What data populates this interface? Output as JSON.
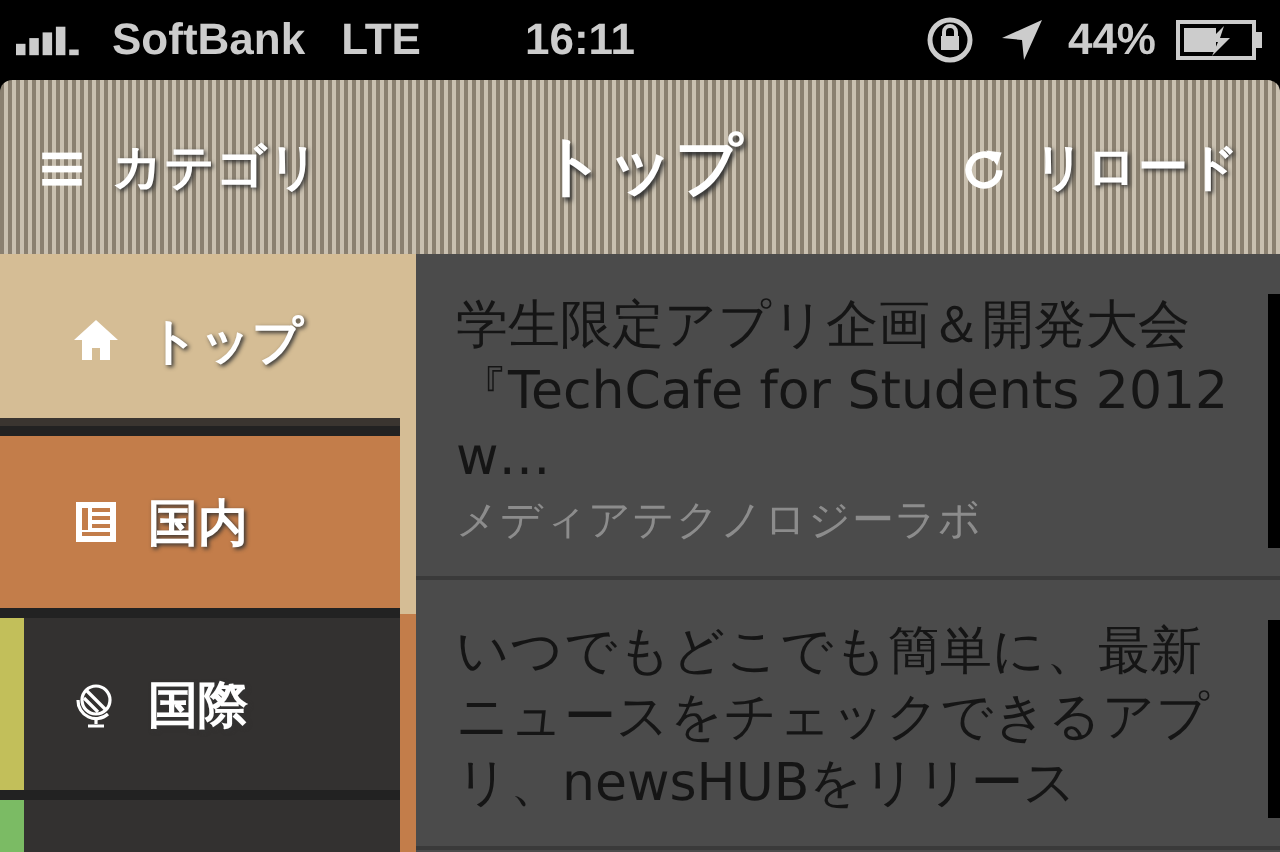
{
  "status_bar": {
    "carrier": "SoftBank",
    "network": "LTE",
    "time": "16:11",
    "battery": "44%"
  },
  "nav_bar": {
    "left_button": "カテゴリ",
    "title": "トップ",
    "right_button": "リロード"
  },
  "sidebar": {
    "items": [
      {
        "label": "トップ",
        "selected": true,
        "highlighted": false
      },
      {
        "label": "国内",
        "selected": false,
        "highlighted": true,
        "color": "#c37d4a"
      },
      {
        "label": "国際",
        "selected": false,
        "highlighted": false,
        "color": "#c2bf5a"
      },
      {
        "selected": false,
        "highlighted": false,
        "color": "#7bbb64"
      }
    ]
  },
  "articles": [
    {
      "title": "学生限定アプリ企画＆開発大会『TechCafe for Students 2012 w…",
      "source": "メディアテクノロジーラボ"
    },
    {
      "title": "いつでもどこでも簡単に、最新ニュースをチェックできるアプリ、newsHUBをリリース"
    }
  ]
}
